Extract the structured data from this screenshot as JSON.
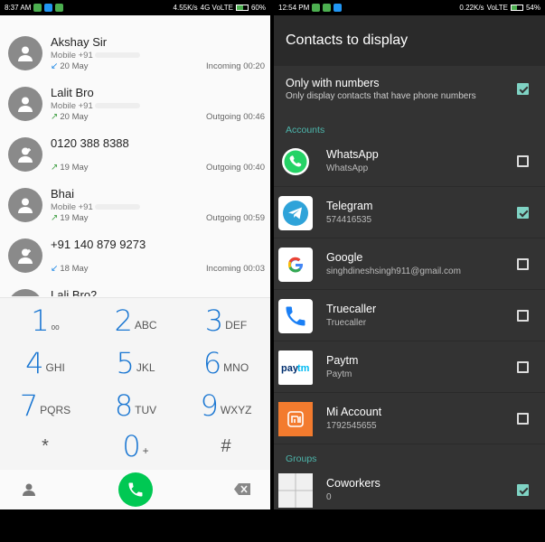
{
  "left": {
    "status_bar": {
      "time": "8:37 AM",
      "speed": "4.55K/s",
      "network": "4G VoLTE",
      "battery": "60%"
    },
    "calls": [
      {
        "name": "Akshay Sir",
        "sub": "Mobile +91",
        "date": "20 May",
        "status": "Incoming 00:20",
        "dir": "in"
      },
      {
        "name": "Lalit Bro",
        "sub": "Mobile +91",
        "date": "20 May",
        "status": "Outgoing 00:46",
        "dir": "out"
      },
      {
        "name": "0120 388 8388",
        "sub": "",
        "date": "19 May",
        "status": "Outgoing 00:40",
        "dir": "out"
      },
      {
        "name": "Bhai",
        "sub": "Mobile +91",
        "date": "19 May",
        "status": "Outgoing 00:59",
        "dir": "out"
      },
      {
        "name": "+91 140 879 9273",
        "sub": "",
        "date": "18 May",
        "status": "Incoming 00:03",
        "dir": "in"
      },
      {
        "name": "Lali Bro2",
        "sub": "",
        "date": "",
        "status": "",
        "dir": ""
      }
    ],
    "dialpad": [
      {
        "digit": "1",
        "letters": "ₒₒ"
      },
      {
        "digit": "2",
        "letters": "ABC"
      },
      {
        "digit": "3",
        "letters": "DEF"
      },
      {
        "digit": "4",
        "letters": "GHI"
      },
      {
        "digit": "5",
        "letters": "JKL"
      },
      {
        "digit": "6",
        "letters": "MNO"
      },
      {
        "digit": "7",
        "letters": "PQRS"
      },
      {
        "digit": "8",
        "letters": "TUV"
      },
      {
        "digit": "9",
        "letters": "WXYZ"
      },
      {
        "digit": "*",
        "letters": ""
      },
      {
        "digit": "0",
        "letters": "+"
      },
      {
        "digit": "#",
        "letters": ""
      }
    ]
  },
  "right": {
    "status_bar": {
      "time": "12:54 PM",
      "speed": "0.22K/s",
      "network": "VoLTE",
      "battery": "54%"
    },
    "title": "Contacts to display",
    "only_numbers": {
      "title": "Only with numbers",
      "subtitle": "Only display contacts that have phone numbers",
      "checked": true
    },
    "accounts_header": "Accounts",
    "accounts": [
      {
        "name": "WhatsApp",
        "detail": "WhatsApp",
        "checked": false,
        "icon": "whatsapp-icon",
        "color": "#25d366"
      },
      {
        "name": "Telegram",
        "detail": "574416535",
        "checked": true,
        "icon": "telegram-icon",
        "color": "#2fa3d9"
      },
      {
        "name": "Google",
        "detail": "singhdineshsingh911@gmail.com",
        "checked": false,
        "icon": "google-icon",
        "color": "#ffffff"
      },
      {
        "name": "Truecaller",
        "detail": "Truecaller",
        "checked": false,
        "icon": "truecaller-icon",
        "color": "#ffffff"
      },
      {
        "name": "Paytm",
        "detail": "Paytm",
        "checked": false,
        "icon": "paytm-icon",
        "color": "#ffffff"
      },
      {
        "name": "Mi Account",
        "detail": "1792545655",
        "checked": false,
        "icon": "mi-account-icon",
        "color": "#f37b2e"
      }
    ],
    "groups_header": "Groups",
    "groups": [
      {
        "name": "Coworkers",
        "detail": "0",
        "checked": true,
        "icon": "group-grid-icon"
      }
    ]
  }
}
